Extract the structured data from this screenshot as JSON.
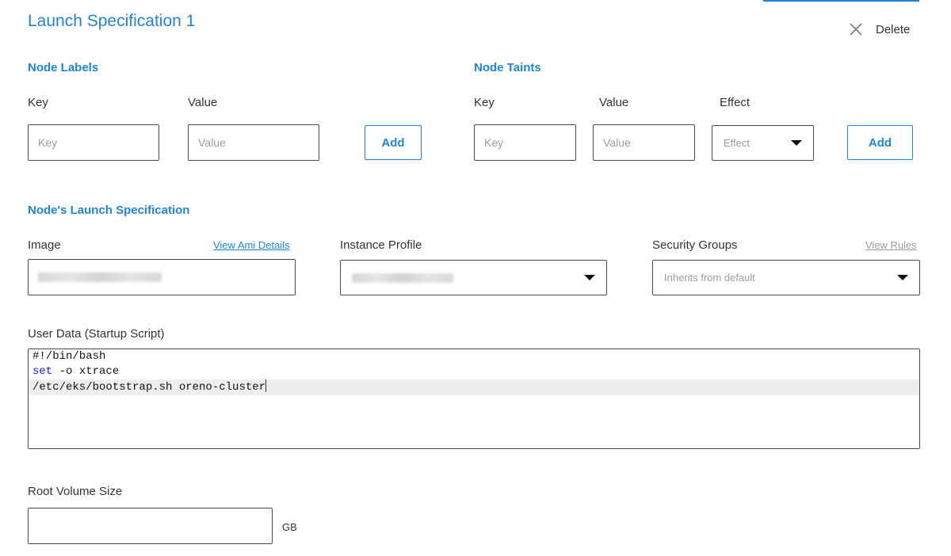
{
  "header": {
    "title": "Launch Specification 1",
    "delete_label": "Delete"
  },
  "node_labels": {
    "section_title": "Node Labels",
    "key_label": "Key",
    "value_label": "Value",
    "key_placeholder": "Key",
    "value_placeholder": "Value",
    "add_label": "Add"
  },
  "node_taints": {
    "section_title": "Node Taints",
    "key_label": "Key",
    "value_label": "Value",
    "effect_label": "Effect",
    "key_placeholder": "Key",
    "value_placeholder": "Value",
    "effect_placeholder": "Effect",
    "add_label": "Add"
  },
  "launch_spec": {
    "section_title": "Node's Launch Specification",
    "image_label": "Image",
    "image_link": "View Ami Details",
    "instance_profile_label": "Instance Profile",
    "security_groups_label": "Security Groups",
    "security_groups_link": "View Rules",
    "security_groups_placeholder": "Inherits from default"
  },
  "user_data": {
    "label": "User Data (Startup Script)",
    "line1": "#!/bin/bash",
    "line2_keyword": "set",
    "line2_rest": " -o xtrace",
    "line3": "/etc/eks/bootstrap.sh oreno-cluster"
  },
  "root_volume": {
    "label": "Root Volume Size",
    "value": "",
    "unit": "GB"
  },
  "colors": {
    "accent": "#1f84d8",
    "border": "#4a4a4a",
    "placeholder": "#9b9b9b"
  }
}
